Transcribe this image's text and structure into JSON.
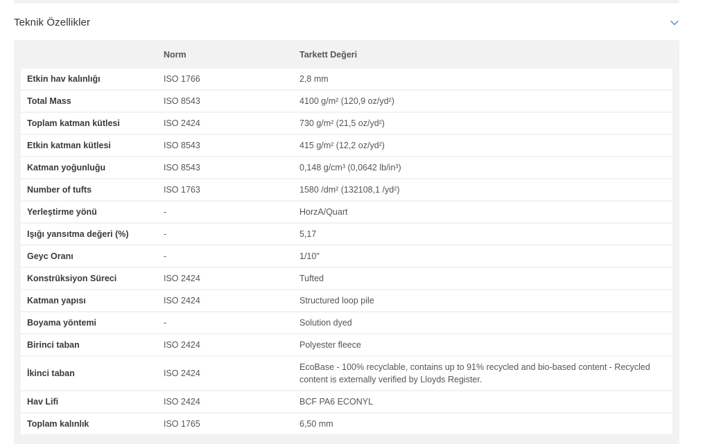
{
  "section": {
    "title": "Teknik Özellikler",
    "expand_icon": "chevron-down-icon"
  },
  "table": {
    "headers": [
      "",
      "Norm",
      "Tarkett Değeri"
    ],
    "rows": [
      {
        "property": "Etkin hav kalınlığı",
        "norm": "ISO 1766",
        "value": "2,8 mm"
      },
      {
        "property": "Total Mass",
        "norm": "ISO 8543",
        "value": "4100 g/m² (120,9 oz/yd²)"
      },
      {
        "property": "Toplam katman kütlesi",
        "norm": "ISO 2424",
        "value": "730 g/m² (21,5 oz/yd²)"
      },
      {
        "property": "Etkin katman kütlesi",
        "norm": "ISO 8543",
        "value": "415 g/m² (12,2 oz/yd²)"
      },
      {
        "property": "Katman yoğunluğu",
        "norm": "ISO 8543",
        "value": "0,148 g/cm³ (0,0642 lb/in³)"
      },
      {
        "property": "Number of tufts",
        "norm": "ISO 1763",
        "value": "1580 /dm² (132108,1 /yd²)"
      },
      {
        "property": "Yerleştirme yönü",
        "norm": "-",
        "value": "HorzA/Quart"
      },
      {
        "property": "Işığı yansıtma değeri (%)",
        "norm": "-",
        "value": "5,17"
      },
      {
        "property": "Geyc Oranı",
        "norm": "-",
        "value": "1/10\""
      },
      {
        "property": "Konstrüksiyon Süreci",
        "norm": "ISO 2424",
        "value": "Tufted"
      },
      {
        "property": "Katman yapısı",
        "norm": "ISO 2424",
        "value": "Structured loop pile"
      },
      {
        "property": "Boyama yöntemi",
        "norm": "-",
        "value": "Solution dyed"
      },
      {
        "property": "Birinci taban",
        "norm": "ISO 2424",
        "value": "Polyester fleece"
      },
      {
        "property": "İkinci taban",
        "norm": "ISO 2424",
        "value": "EcoBase - 100% recyclable, contains up to 91% recycled and bio-based content - Recycled content is externally verified by Lloyds Register."
      },
      {
        "property": "Hav Lifi",
        "norm": "ISO 2424",
        "value": "BCF PA6 ECONYL"
      },
      {
        "property": "Toplam kalınlık",
        "norm": "ISO 1765",
        "value": "6,50 mm"
      }
    ]
  }
}
